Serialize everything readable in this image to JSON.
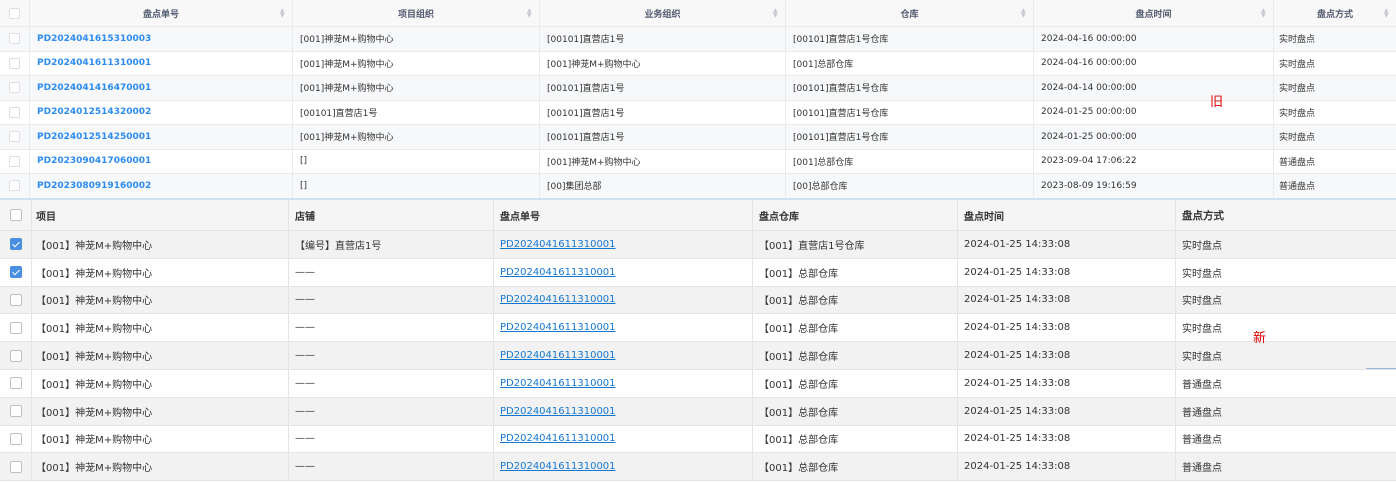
{
  "old_table": {
    "headers": [
      "盘点单号",
      "项目组织",
      "业务组织",
      "仓库",
      "盘点时间",
      "盘点方式"
    ],
    "rows": [
      {
        "code": "PD2024041615310003",
        "project": "[001]神茏M+购物中心",
        "business": "[00101]直营店1号",
        "warehouse": "[00101]直营店1号仓库",
        "time": "2024-04-16 00:00:00",
        "method": "实时盘点"
      },
      {
        "code": "PD2024041611310001",
        "project": "[001]神茏M+购物中心",
        "business": "[001]神茏M+购物中心",
        "warehouse": "[001]总部仓库",
        "time": "2024-04-16 00:00:00",
        "method": "实时盘点"
      },
      {
        "code": "PD2024041416470001",
        "project": "[001]神茏M+购物中心",
        "business": "[00101]直营店1号",
        "warehouse": "[00101]直营店1号仓库",
        "time": "2024-04-14 00:00:00",
        "method": "实时盘点"
      },
      {
        "code": "PD2024012514320002",
        "project": "[00101]直营店1号",
        "business": "[00101]直营店1号",
        "warehouse": "[00101]直营店1号仓库",
        "time": "2024-01-25 00:00:00",
        "method": "实时盘点"
      },
      {
        "code": "PD2024012514250001",
        "project": "[001]神茏M+购物中心",
        "business": "[00101]直营店1号",
        "warehouse": "[00101]直营店1号仓库",
        "time": "2024-01-25 00:00:00",
        "method": "实时盘点"
      },
      {
        "code": "PD2023090417060001",
        "project": "[]",
        "business": "[001]神茏M+购物中心",
        "warehouse": "[001]总部仓库",
        "time": "2023-09-04 17:06:22",
        "method": "普通盘点"
      },
      {
        "code": "PD2023080919160002",
        "project": "[]",
        "business": "[00]集团总部",
        "warehouse": "[00]总部仓库",
        "time": "2023-08-09 19:16:59",
        "method": "普通盘点"
      }
    ]
  },
  "old_marker": "旧",
  "new_table": {
    "headers": [
      "项目",
      "店铺",
      "盘点单号",
      "盘点仓库",
      "盘点时间",
      "盘点方式"
    ],
    "rows": [
      {
        "checked": true,
        "project": "【001】神茏M+购物中心",
        "shop": "【编号】直营店1号",
        "code": "PD2024041611310001",
        "warehouse": "【001】直营店1号仓库",
        "time": "2024-01-25 14:33:08",
        "method": "实时盘点"
      },
      {
        "checked": true,
        "project": "【001】神茏M+购物中心",
        "shop": "——",
        "code": "PD2024041611310001",
        "warehouse": "【001】总部仓库",
        "time": "2024-01-25 14:33:08",
        "method": "实时盘点"
      },
      {
        "checked": false,
        "project": "【001】神茏M+购物中心",
        "shop": "——",
        "code": "PD2024041611310001",
        "warehouse": "【001】总部仓库",
        "time": "2024-01-25 14:33:08",
        "method": "实时盘点"
      },
      {
        "checked": false,
        "project": "【001】神茏M+购物中心",
        "shop": "——",
        "code": "PD2024041611310001",
        "warehouse": "【001】总部仓库",
        "time": "2024-01-25 14:33:08",
        "method": "实时盘点"
      },
      {
        "checked": false,
        "project": "【001】神茏M+购物中心",
        "shop": "——",
        "code": "PD2024041611310001",
        "warehouse": "【001】总部仓库",
        "time": "2024-01-25 14:33:08",
        "method": "实时盘点"
      },
      {
        "checked": false,
        "project": "【001】神茏M+购物中心",
        "shop": "——",
        "code": "PD2024041611310001",
        "warehouse": "【001】总部仓库",
        "time": "2024-01-25 14:33:08",
        "method": "普通盘点"
      },
      {
        "checked": false,
        "project": "【001】神茏M+购物中心",
        "shop": "——",
        "code": "PD2024041611310001",
        "warehouse": "【001】总部仓库",
        "time": "2024-01-25 14:33:08",
        "method": "普通盘点"
      },
      {
        "checked": false,
        "project": "【001】神茏M+购物中心",
        "shop": "——",
        "code": "PD2024041611310001",
        "warehouse": "【001】总部仓库",
        "time": "2024-01-25 14:33:08",
        "method": "普通盘点"
      },
      {
        "checked": false,
        "project": "【001】神茏M+购物中心",
        "shop": "——",
        "code": "PD2024041611310001",
        "warehouse": "【001】总部仓库",
        "time": "2024-01-25 14:33:08",
        "method": "普通盘点"
      }
    ]
  },
  "new_marker": "新",
  "colors": {
    "link_old": "#2d8cf0",
    "link_new": "#1677d2",
    "marker": "#e00000",
    "checkbox_checked": "#4a90e2"
  }
}
